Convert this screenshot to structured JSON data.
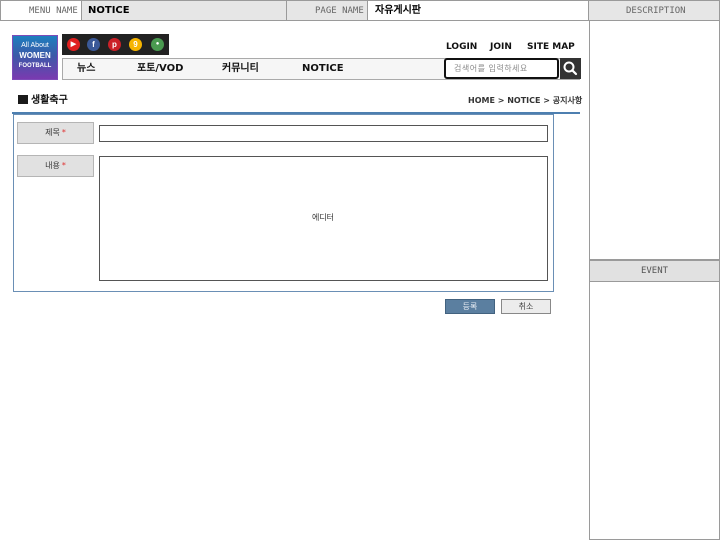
{
  "header": {
    "menu_name_label": "MENU NAME",
    "menu_name_value": "NOTICE",
    "page_name_label": "PAGE NAME",
    "page_name_value": "자유게시판",
    "description_label": "DESCRIPTION"
  },
  "side": {
    "event_label": "EVENT"
  },
  "logo": {
    "line1": "All About",
    "line2": "WOMEN",
    "line3": "FOOTBALL"
  },
  "social_icons": [
    {
      "name": "youtube-icon",
      "glyph": "▶",
      "color": "#e02020"
    },
    {
      "name": "facebook-icon",
      "glyph": "f",
      "color": "#3b5998"
    },
    {
      "name": "pinterest-icon",
      "glyph": "p",
      "color": "#cb2027"
    },
    {
      "name": "kakaostory-icon",
      "glyph": "9",
      "color": "#f6b400"
    },
    {
      "name": "other-sns-icon",
      "glyph": "●",
      "color": "#4a9a50"
    }
  ],
  "top_links": {
    "login": "LOGIN",
    "join": "JOIN",
    "sitemap": "SITE MAP"
  },
  "nav": {
    "items": [
      "뉴스",
      "포토/VOD",
      "커뮤니티",
      "NOTICE"
    ]
  },
  "search": {
    "placeholder": "검색어를 입력하세요"
  },
  "page": {
    "title": "생활축구",
    "breadcrumb": "HOME > NOTICE > 공지사항"
  },
  "form": {
    "title_label": "제목",
    "content_label": "내용",
    "required_mark": "*",
    "editor_text": "에디터"
  },
  "buttons": {
    "submit": "등록",
    "cancel": "취소"
  },
  "colors": {
    "accent_blue": "#4d7fb0",
    "required_red": "#e03030",
    "submit_button": "#5b7fa0"
  }
}
